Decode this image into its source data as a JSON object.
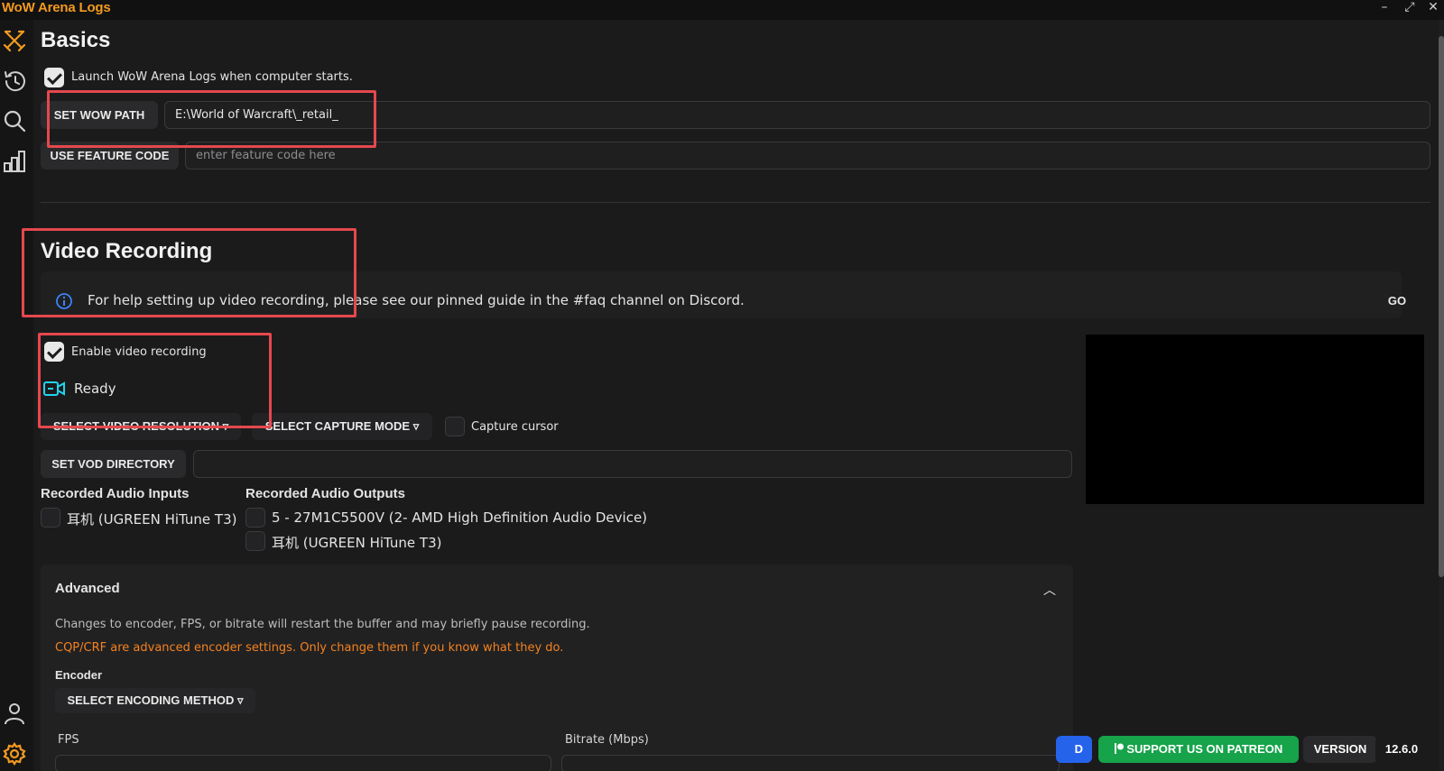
{
  "app": {
    "title": "WoW Arena Logs"
  },
  "window": {
    "minimize": "–",
    "maximize": "⤢",
    "close": "✕"
  },
  "sidebar": {
    "items": [
      {
        "name": "matches",
        "icon": "crossed-swords-icon"
      },
      {
        "name": "history",
        "icon": "history-icon"
      },
      {
        "name": "search",
        "icon": "search-icon"
      },
      {
        "name": "stats",
        "icon": "bar-chart-icon"
      }
    ],
    "bottom": [
      {
        "name": "profile",
        "icon": "user-icon"
      },
      {
        "name": "settings",
        "icon": "gear-icon",
        "active": true
      }
    ],
    "accent": "#f39a1e"
  },
  "basics": {
    "title": "Basics",
    "launch_on_start": {
      "label": "Launch WoW Arena Logs when computer starts.",
      "checked": true
    },
    "wow_path": {
      "button": "SET WOW PATH",
      "value": "E:\\World of Warcraft\\_retail_"
    },
    "feature_code": {
      "button": "USE FEATURE CODE",
      "placeholder": "enter feature code here"
    }
  },
  "video": {
    "title": "Video Recording",
    "info_text": "For help setting up video recording, please see our pinned guide in the #faq channel on Discord.",
    "info_go": "GO",
    "enable": {
      "label": "Enable video recording",
      "checked": true
    },
    "status": "Ready",
    "resolution_button": "SELECT VIDEO RESOLUTION",
    "capture_mode_button": "SELECT CAPTURE MODE",
    "capture_cursor": {
      "label": "Capture cursor",
      "checked": false
    },
    "vod_directory": {
      "button": "SET VOD DIRECTORY",
      "value": ""
    },
    "audio_inputs": {
      "title": "Recorded Audio Inputs",
      "items": [
        "耳机 (UGREEN HiTune T3)"
      ]
    },
    "audio_outputs": {
      "title": "Recorded Audio Outputs",
      "items": [
        "5 - 27M1C5500V (2- AMD High Definition Audio Device)",
        "耳机 (UGREEN HiTune T3)"
      ]
    }
  },
  "advanced": {
    "title": "Advanced",
    "note": "Changes to encoder, FPS, or bitrate will restart the buffer and may briefly pause recording.",
    "warning": "CQP/CRF are advanced encoder settings. Only change them if you know what they do.",
    "encoder_label": "Encoder",
    "encoder_button": "SELECT ENCODING METHOD",
    "fps_label": "FPS",
    "bitrate_label": "Bitrate (Mbps)"
  },
  "footer": {
    "discord_partial": "D",
    "patreon": "SUPPORT US ON PATREON",
    "version_label": "VERSION",
    "version": "12.6.0"
  },
  "colors": {
    "info_icon": "#3b82f6",
    "ready_icon": "#22d3ee",
    "patreon": "#16a34a",
    "discord": "#2563eb",
    "highlight": "#e5484d",
    "warning": "#f5821f"
  }
}
